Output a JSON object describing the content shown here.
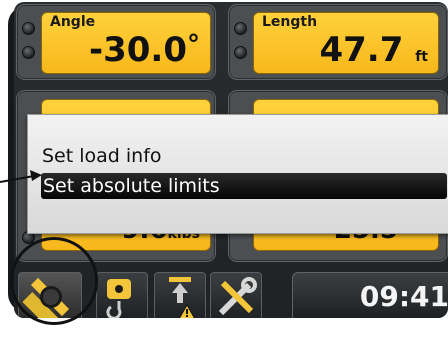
{
  "panels": {
    "angle": {
      "label": "Angle",
      "value": "-30.0",
      "unit": "°"
    },
    "length": {
      "label": "Length",
      "value": "47.7",
      "unit": "ft"
    },
    "load": {
      "value": "9.6",
      "unit": "klbs"
    },
    "height": {
      "value": "25.5"
    }
  },
  "popup_menu": {
    "items": [
      {
        "label": "Set load info"
      },
      {
        "label": "Set absolute limits",
        "selected": true
      }
    ]
  },
  "toolbar": {
    "buttons": [
      {
        "icon": "boom-ruler-icon",
        "highlighted": true
      },
      {
        "icon": "hook-load-icon"
      },
      {
        "icon": "height-warning-icon"
      },
      {
        "icon": "tools-icon"
      }
    ],
    "clock": "09:41"
  },
  "colors": {
    "value_box": "#f9c32a",
    "panel": "#4b4f52",
    "screen_bg": "#222527",
    "selected_menu": "#0a0a0a"
  }
}
